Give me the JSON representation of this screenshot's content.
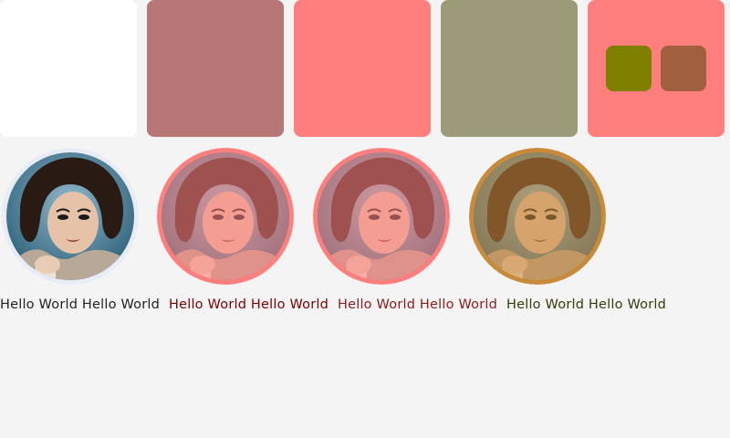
{
  "palette": {
    "swatch_1": "#ffffff",
    "swatch_2": "#b87777",
    "swatch_3": "#ff7f7f",
    "swatch_4": "#9c9a79",
    "swatch_5": "#ff7f7f",
    "chip_1": "#808000",
    "chip_2": "#a0603f"
  },
  "avatars": [
    {
      "icon": "portrait-photo",
      "tint": "none",
      "ring": "#e8ecf6"
    },
    {
      "icon": "portrait-photo",
      "tint": "#ff7f7f",
      "ring": "#ff7f7f"
    },
    {
      "icon": "portrait-photo",
      "tint": "#ff7f7f",
      "ring": "#ff7f7f"
    },
    {
      "icon": "portrait-photo",
      "tint": "#c98a3a",
      "ring": "#c98a3a"
    }
  ],
  "captions": [
    {
      "text": "Hello World Hello World",
      "color": "#222222"
    },
    {
      "text": "Hello World Hello World",
      "color": "#7a0000"
    },
    {
      "text": "Hello World Hello World",
      "color": "#8b1a1a"
    },
    {
      "text": "Hello World Hello World",
      "color": "#3a3a0a"
    }
  ]
}
